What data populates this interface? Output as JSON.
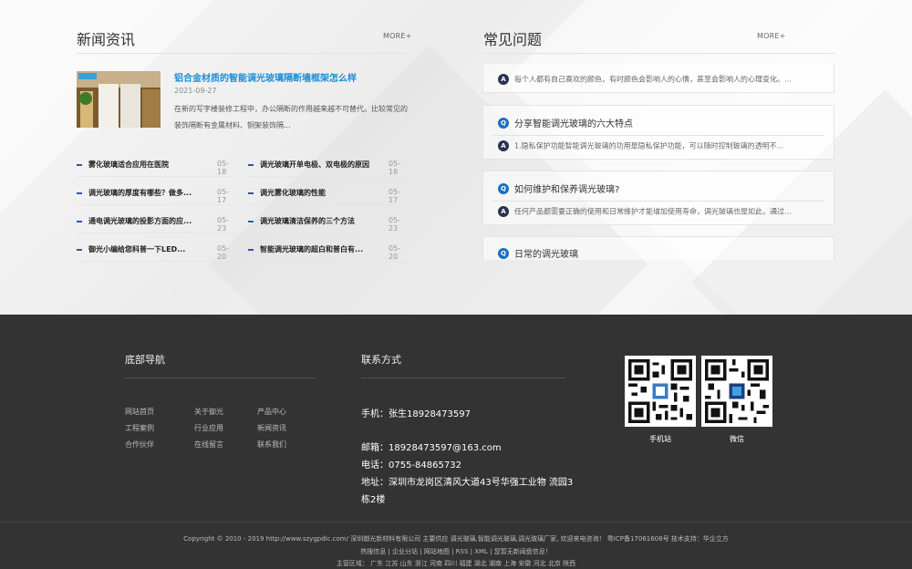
{
  "news": {
    "title": "新闻资讯",
    "more": "MORE+",
    "featured": {
      "headline": "铝合金材质的智能调光玻璃隔断墙框架怎么样",
      "date": "2021-09-27",
      "summary": "在新的写字楼装修工程中，办公隔断的作用越来越不可替代。比较常见的装饰隔断有金属材料、铜架装饰隔..."
    },
    "list": [
      {
        "text": "雾化玻璃适合应用在医院",
        "date": "05-18"
      },
      {
        "text": "调光玻璃开单电极、双电极的原因",
        "date": "05-18"
      },
      {
        "text": "调光玻璃的厚度有哪些？做多...",
        "date": "05-17"
      },
      {
        "text": "调光雾化玻璃的性能",
        "date": "05-17"
      },
      {
        "text": "通电调光玻璃的投影方面的应...",
        "date": "05-23"
      },
      {
        "text": "调光玻璃清洁保养的三个方法",
        "date": "05-23"
      },
      {
        "text": "御光小编给您科普一下LED...",
        "date": "05-20"
      },
      {
        "text": "智能调光玻璃的超白和普白有...",
        "date": "05-20"
      }
    ]
  },
  "faq": {
    "title": "常见问题",
    "more": "MORE+",
    "q_mark": "Q",
    "a_mark": "A",
    "first_answer": "每个人都有自己喜欢的颜色，有时颜色会影响人的心情，甚至会影响人的心理变化。...",
    "items": [
      {
        "q": "分享智能调光玻璃的六大特点",
        "a": "1.隐私保护功能智能调光玻璃的功用是隐私保护功能，可以随时控制玻璃的透明不..."
      },
      {
        "q": "如何维护和保养调光玻璃?",
        "a": "任何产品都需要正确的使用和日常维护才能增加使用寿命，调光玻璃也是如此，通过..."
      },
      {
        "q": "日常的调光玻璃",
        "a": ""
      }
    ]
  },
  "footer": {
    "nav_title": "底部导航",
    "nav_links": [
      "网站首页",
      "关于御光",
      "产品中心",
      "工程案例",
      "行业应用",
      "新闻资讯",
      "合作伙伴",
      "在线留言",
      "联系我们"
    ],
    "contact_title": "联系方式",
    "phone_label": "手机：张生18928473597",
    "email_label": "邮箱：18928473597@163.com",
    "tel_label": "电话：0755-84865732",
    "address_line1": "地址：深圳市龙岗区清风大道43号华强工业物 流园3",
    "address_line2": "栋2楼",
    "qr_mobile": "手机站",
    "qr_wechat": "微信",
    "copyright": "Copyright © 2010 - 2019 http://www.szygpdlc.com/ 深圳御光新材料有限公司 主要供应 调光玻璃,智能调光玻璃,调光玻璃厂家, 欢迎来电咨询！ 粤ICP备17061608号 技术支持：华企立方",
    "links_line": "热搜信息 | 企业分站 | 网站地图 | RSS | XML | 您暂无新闻盘信息！",
    "regions_line": "主营区域： 广东 江苏 山东 浙江 河南 四川 福建 湖北 湖南 上海 安徽 河北 北京 陕西"
  }
}
